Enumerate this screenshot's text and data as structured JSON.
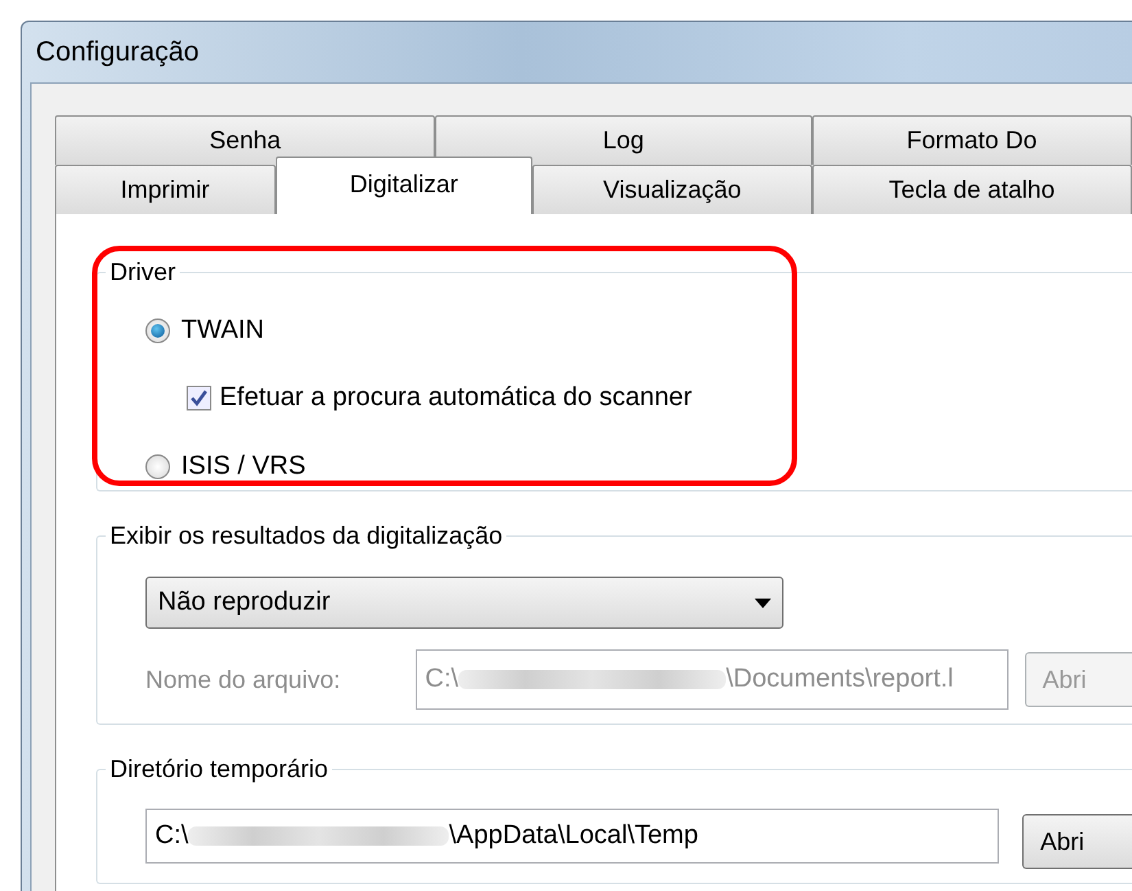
{
  "window": {
    "title": "Configuração"
  },
  "tabs": [
    [
      {
        "label": "Senha",
        "selected": false
      },
      {
        "label": "Log",
        "selected": false
      },
      {
        "label": "Formato Do",
        "selected": false
      }
    ],
    [
      {
        "label": "Imprimir",
        "selected": false
      },
      {
        "label": "Digitalizar",
        "selected": true
      },
      {
        "label": "Visualização",
        "selected": false
      },
      {
        "label": "Tecla de atalho",
        "selected": false
      }
    ]
  ],
  "driver": {
    "legend": "Driver",
    "highlighted": true,
    "options": [
      {
        "kind": "radio",
        "label": "TWAIN",
        "selected": true
      },
      {
        "kind": "checkbox",
        "label": "Efetuar a procura automática do scanner",
        "checked": true
      },
      {
        "kind": "radio",
        "label": "ISIS / VRS",
        "selected": false
      }
    ]
  },
  "results": {
    "legend": "Exibir os resultados da digitalização",
    "dropdown": "Não reproduzir",
    "file_label": "Nome do arquivo:",
    "file_path_start": "C:\\",
    "file_path_end": "\\Documents\\report.l",
    "file_disabled": true,
    "button": "Abri"
  },
  "temp": {
    "legend": "Diretório temporário",
    "path_start": "C:\\",
    "path_end": "\\AppData\\Local\\Temp",
    "button": "Abri"
  }
}
